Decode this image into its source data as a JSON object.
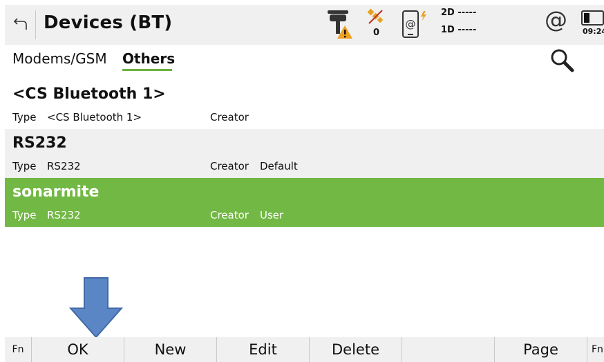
{
  "header": {
    "title": "Devices (BT)",
    "satellite_count": "0",
    "quality_2d": "2D -----",
    "quality_1d": "1D -----",
    "clock": "09:24",
    "at_symbol": "@"
  },
  "tabs": [
    {
      "label": "Modems/GSM",
      "active": false
    },
    {
      "label": "Others",
      "active": true
    }
  ],
  "list": {
    "type_label": "Type",
    "creator_label": "Creator",
    "items": [
      {
        "name": "<CS Bluetooth 1>",
        "type": "<CS Bluetooth 1>",
        "creator": "",
        "selected": false
      },
      {
        "name": "RS232",
        "type": "RS232",
        "creator": "Default",
        "selected": false
      },
      {
        "name": "sonarmite",
        "type": "RS232",
        "creator": "User",
        "selected": true
      }
    ]
  },
  "softkeys": {
    "fn_left": "Fn",
    "ok": "OK",
    "new": "New",
    "edit": "Edit",
    "delete": "Delete",
    "empty": "",
    "page": "Page",
    "fn_right": "Fn"
  },
  "colors": {
    "accent_green": "#72b844",
    "header_bg": "#f0f0f0",
    "arrow_fill": "#5b86c5",
    "arrow_stroke": "#3f6aa6"
  },
  "icons": [
    "back-icon",
    "gps-antenna-warning-icon",
    "satellite-icon",
    "device-at-icon",
    "at-icon",
    "battery-icon",
    "search-icon",
    "down-arrow-annotation-icon"
  ]
}
